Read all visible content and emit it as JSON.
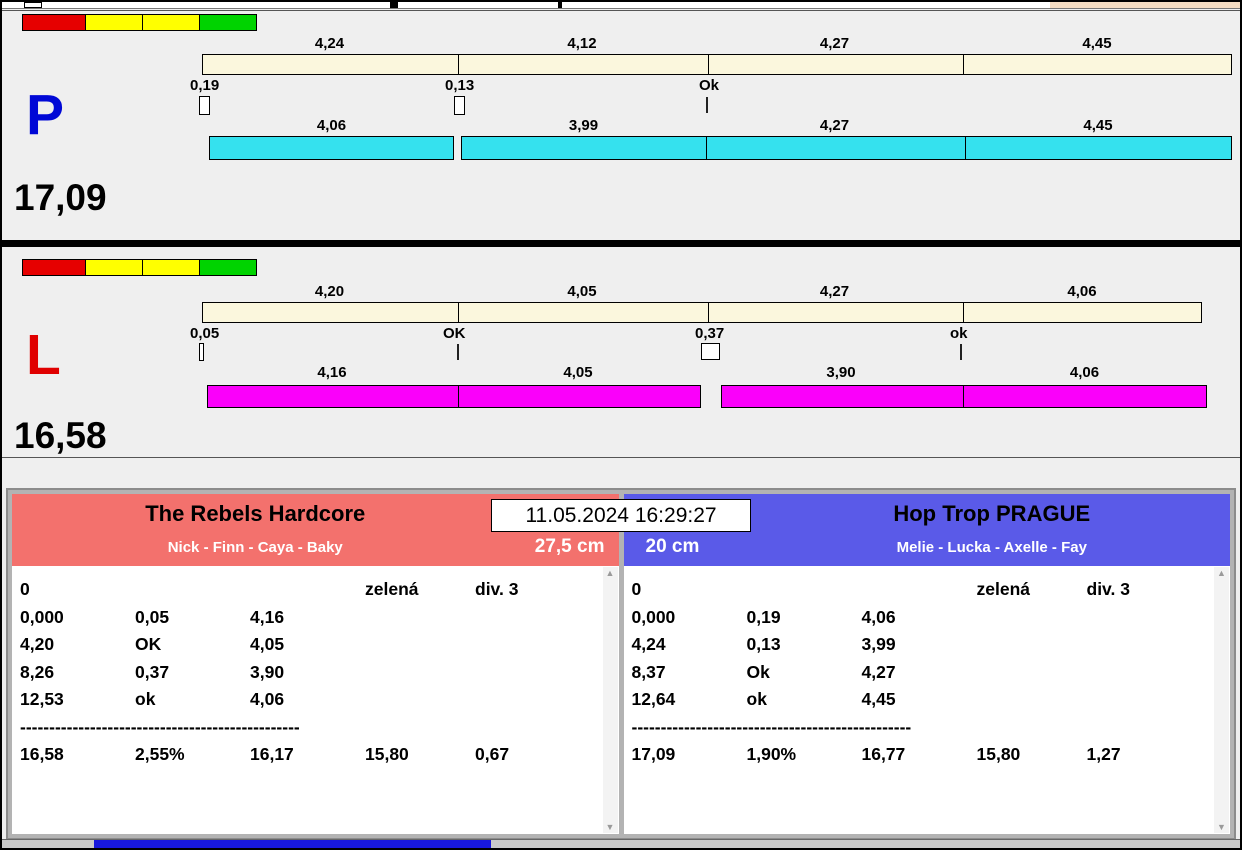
{
  "datetime": "11.05.2024 16:29:27",
  "lanes": {
    "p": {
      "letter": "P",
      "total": "17,09",
      "top_values": [
        "4,24",
        "4,12",
        "4,27",
        "4,45"
      ],
      "marker_labels": [
        "0,19",
        "0,13",
        "Ok"
      ],
      "bottom_values": [
        "4,06",
        "3,99",
        "4,27",
        "4,45"
      ]
    },
    "l": {
      "letter": "L",
      "total": "16,58",
      "top_values": [
        "4,20",
        "4,05",
        "4,27",
        "4,06"
      ],
      "marker_labels": [
        "0,05",
        "OK",
        "0,37",
        "ok"
      ],
      "bottom_values": [
        "4,16",
        "4,05",
        "3,90",
        "4,06"
      ]
    }
  },
  "teams": {
    "left": {
      "name": "The Rebels Hardcore",
      "members": "Nick - Finn - Caya - Baky",
      "board_height": "27,5 cm",
      "info_row": {
        "c1": "0",
        "c4": "zelená",
        "c5": "div. 3"
      },
      "splits": [
        {
          "c1": "0,000",
          "c2": "0,05",
          "c3": "4,16"
        },
        {
          "c1": "4,20",
          "c2": "OK",
          "c3": "4,05"
        },
        {
          "c1": "8,26",
          "c2": "0,37",
          "c3": "3,90"
        },
        {
          "c1": "12,53",
          "c2": "ok",
          "c3": "4,06"
        }
      ],
      "divider": "------------------------------------------------",
      "totals": {
        "c1": "16,58",
        "c2": "2,55%",
        "c3": "16,17",
        "c4": "15,80",
        "c5": "0,67"
      }
    },
    "right": {
      "name": "Hop Trop PRAGUE",
      "members": "Melie - Lucka - Axelle - Fay",
      "board_height": "20 cm",
      "info_row": {
        "c1": "0",
        "c4": "zelená",
        "c5": "div. 3"
      },
      "splits": [
        {
          "c1": "0,000",
          "c2": "0,19",
          "c3": "4,06"
        },
        {
          "c1": "4,24",
          "c2": "0,13",
          "c3": "3,99"
        },
        {
          "c1": "8,37",
          "c2": "Ok",
          "c3": "4,27"
        },
        {
          "c1": "12,64",
          "c2": "ok",
          "c3": "4,45"
        }
      ],
      "divider": "------------------------------------------------",
      "totals": {
        "c1": "17,09",
        "c2": "1,90%",
        "c3": "16,77",
        "c4": "15,80",
        "c5": "1,27"
      }
    }
  },
  "colors": {
    "p_bar": "#35E1EE",
    "l_bar": "#FA00FA",
    "split_bar": "#FBF7DD",
    "team_left_header": "#F3716D",
    "team_right_header": "#5A5AE8",
    "light_red": "#E60000",
    "light_yellow": "#FFFF00",
    "light_green": "#00D300",
    "p_letter": "#0008D6",
    "l_letter": "#E00000",
    "taskbar_blue": "#1818DC"
  }
}
